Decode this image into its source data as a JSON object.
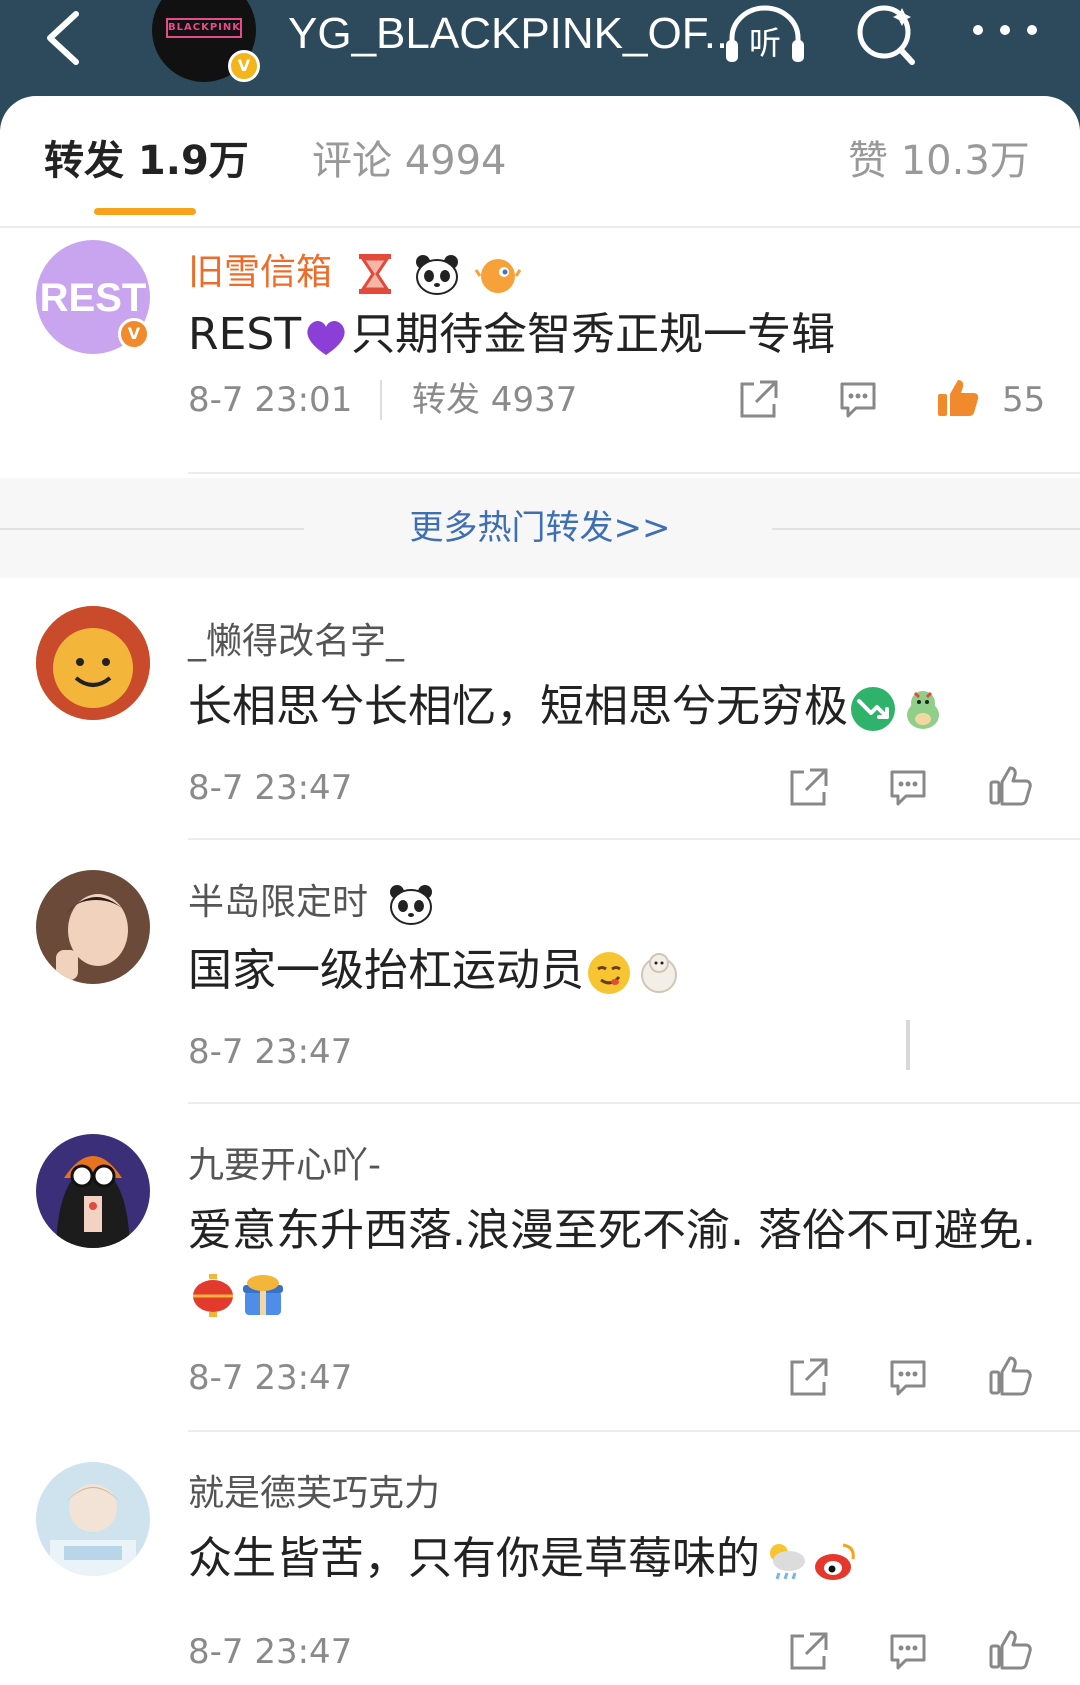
{
  "header": {
    "title": "YG_BLACKPINK_OF...",
    "avatar_text": "BLACKPINK",
    "listen_label": "听",
    "verified_mark": "V"
  },
  "tabs": [
    {
      "label": "转发 1.9万",
      "active": true
    },
    {
      "label": "评论 4994",
      "active": false
    },
    {
      "label": "赞 10.3万",
      "active": false
    }
  ],
  "hot_repost": {
    "username": "旧雪信箱",
    "avatar_text": "REST",
    "content_before": "REST",
    "content_after": "只期待金智秀正规一专辑",
    "time": "8-7 23:01",
    "repost_count": "转发 4937",
    "like_count": "55"
  },
  "more_link": "更多热门转发>>",
  "comments": [
    {
      "username": "_懒得改名字_",
      "content": "长相思兮长相忆，短相思兮无穷极",
      "time": "8-7 23:47"
    },
    {
      "username": "半岛限定时",
      "content": "国家一级抬杠运动员",
      "time": "8-7 23:47"
    },
    {
      "username": "九要开心吖-",
      "content": "爱意东升西落.浪漫至死不渝. 落俗不可避免.",
      "time": "8-7 23:47"
    },
    {
      "username": "就是德芙巧克力",
      "content": "众生皆苦，只有你是草莓味的",
      "time": "8-7 23:47"
    }
  ],
  "colors": {
    "topbar": "#2c4a5c",
    "accent": "#f7a21b",
    "link": "#3f6fb3",
    "hot_username": "#ee6b2a",
    "like_active": "#f08a2c"
  }
}
